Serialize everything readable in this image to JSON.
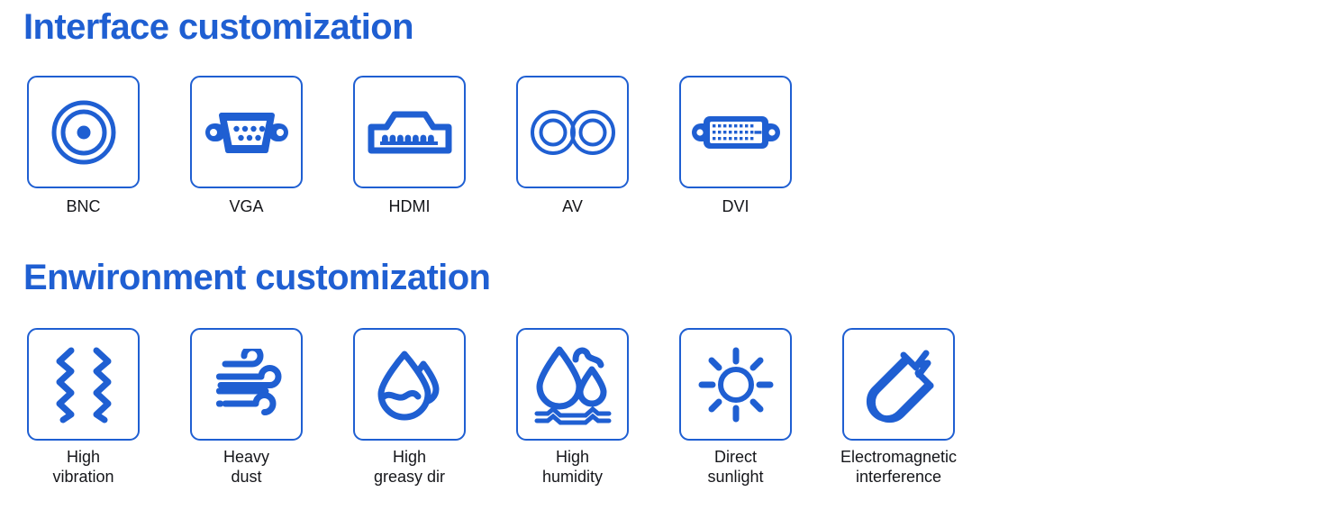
{
  "colors": {
    "accent": "#1f5fd2",
    "label": "#15161a",
    "background": "#ffffff"
  },
  "sections": [
    {
      "id": "interface",
      "title": "Interface customization",
      "items": [
        {
          "label": "BNC",
          "icon": "bnc-connector-icon"
        },
        {
          "label": "VGA",
          "icon": "vga-connector-icon"
        },
        {
          "label": "HDMI",
          "icon": "hdmi-connector-icon"
        },
        {
          "label": "AV",
          "icon": "av-connector-icon"
        },
        {
          "label": "DVI",
          "icon": "dvi-connector-icon"
        }
      ]
    },
    {
      "id": "environment",
      "title": "Enwironment customization",
      "items": [
        {
          "label": "High\nvibration",
          "icon": "vibration-icon"
        },
        {
          "label": "Heavy\ndust",
          "icon": "dust-wind-icon"
        },
        {
          "label": "High\ngreasy dir",
          "icon": "grease-droplet-icon"
        },
        {
          "label": "High\nhumidity",
          "icon": "humidity-droplets-icon"
        },
        {
          "label": "Direct\nsunlight",
          "icon": "sun-icon"
        },
        {
          "label": "Electromagnetic\ninterference",
          "icon": "magnet-interference-icon"
        }
      ]
    }
  ]
}
